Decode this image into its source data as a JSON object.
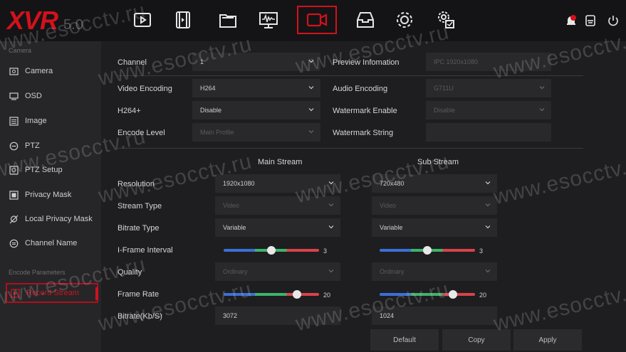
{
  "logo": {
    "brand": "XVR",
    "version": "5.0"
  },
  "topbar": {
    "icons": [
      "playback-icon",
      "video-clip-icon",
      "folder-icon",
      "monitor-waveform-icon",
      "camera-record-icon",
      "storage-icon",
      "settings-gear-icon",
      "system-gear-icon"
    ],
    "active": "camera-record-icon",
    "right_icons": [
      "alarm-icon",
      "backup-icon",
      "power-icon"
    ]
  },
  "sidebar": {
    "section_camera": "Camera",
    "items": [
      {
        "label": "Camera",
        "icon": "camera-icon"
      },
      {
        "label": "OSD",
        "icon": "monitor-icon"
      },
      {
        "label": "Image",
        "icon": "image-icon"
      },
      {
        "label": "PTZ",
        "icon": "ptz-icon"
      },
      {
        "label": "PTZ Setup",
        "icon": "ptz-setup-icon"
      },
      {
        "label": "Privacy Mask",
        "icon": "privacy-mask-icon"
      },
      {
        "label": "Local Privacy Mask",
        "icon": "local-privacy-icon"
      },
      {
        "label": "Channel Name",
        "icon": "channel-name-icon"
      }
    ],
    "section_encode": "Encode Parameters",
    "active_item": {
      "label": "Record Stream",
      "icon": "record-stream-icon"
    }
  },
  "form": {
    "channel_label": "Channel",
    "channel_value": "1",
    "preview_label": "Preview Infomation",
    "preview_value": "IPC 1920x1080",
    "video_encoding_label": "Video Encoding",
    "video_encoding_value": "H264",
    "audio_encoding_label": "Audio Encoding",
    "audio_encoding_value": "G711U",
    "h264plus_label": "H264+",
    "h264plus_value": "Disable",
    "watermark_enable_label": "Watermark Enable",
    "watermark_enable_value": "Disable",
    "encode_level_label": "Encode Level",
    "encode_level_value": "Main Profile",
    "watermark_string_label": "Watermark String",
    "watermark_string_value": ""
  },
  "streams": {
    "main_title": "Main Stream",
    "sub_title": "Sub Stream",
    "resolution_label": "Resolution",
    "stream_type_label": "Stream Type",
    "bitrate_type_label": "Bitrate Type",
    "iframe_label": "I-Frame Interval",
    "quality_label": "Quality",
    "frame_rate_label": "Frame Rate",
    "bitrate_label": "Bitrate(Kb/S)",
    "main": {
      "resolution": "1920x1080",
      "stream_type": "Video",
      "bitrate_type": "Variable",
      "iframe": "3",
      "iframe_level": 0.5,
      "quality": "Ordinary",
      "frame_rate": "20",
      "frame_rate_level": 0.77,
      "bitrate": "3072"
    },
    "sub": {
      "resolution": "720x480",
      "stream_type": "Video",
      "bitrate_type": "Variable",
      "iframe": "3",
      "iframe_level": 0.5,
      "quality": "Ordinary",
      "frame_rate": "20",
      "frame_rate_level": 0.77,
      "bitrate": "1024"
    }
  },
  "buttons": {
    "default": "Default",
    "copy": "Copy",
    "apply": "Apply"
  },
  "watermark_text": "www.esocctv.ru",
  "colors": {
    "accent": "#d3111b",
    "slider_blue": "#3b6fd6",
    "slider_green": "#3fb36a",
    "slider_red": "#d9434a"
  }
}
